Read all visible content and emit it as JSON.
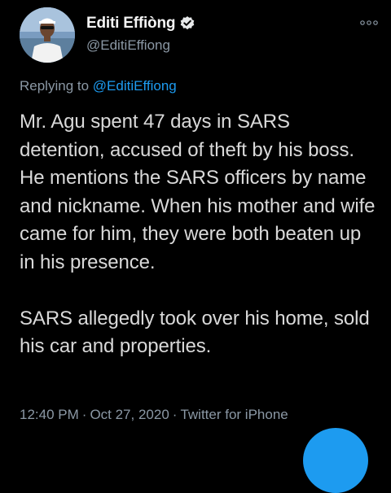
{
  "tweet": {
    "display_name": "Editi Effiòng",
    "handle": "@EditiEffiong",
    "more_icon": "more-dots-icon",
    "replying_prefix": "Replying to",
    "replying_to": "@EditiEffiong",
    "paragraphs": [
      "Mr. Agu spent 47 days in SARS detention, accused of theft by his boss. He mentions the SARS officers by name and nickname. When his mother and wife came for him, they were both beaten up in his presence.",
      "SARS allegedly took over his home, sold his car and properties."
    ],
    "time": "12:40 PM",
    "date": "Oct 27, 2020",
    "source": "Twitter for iPhone"
  },
  "colors": {
    "background": "#000000",
    "accent": "#1d9bf0",
    "secondary_text": "#8b98a5",
    "primary_text": "#d9d9d9"
  }
}
